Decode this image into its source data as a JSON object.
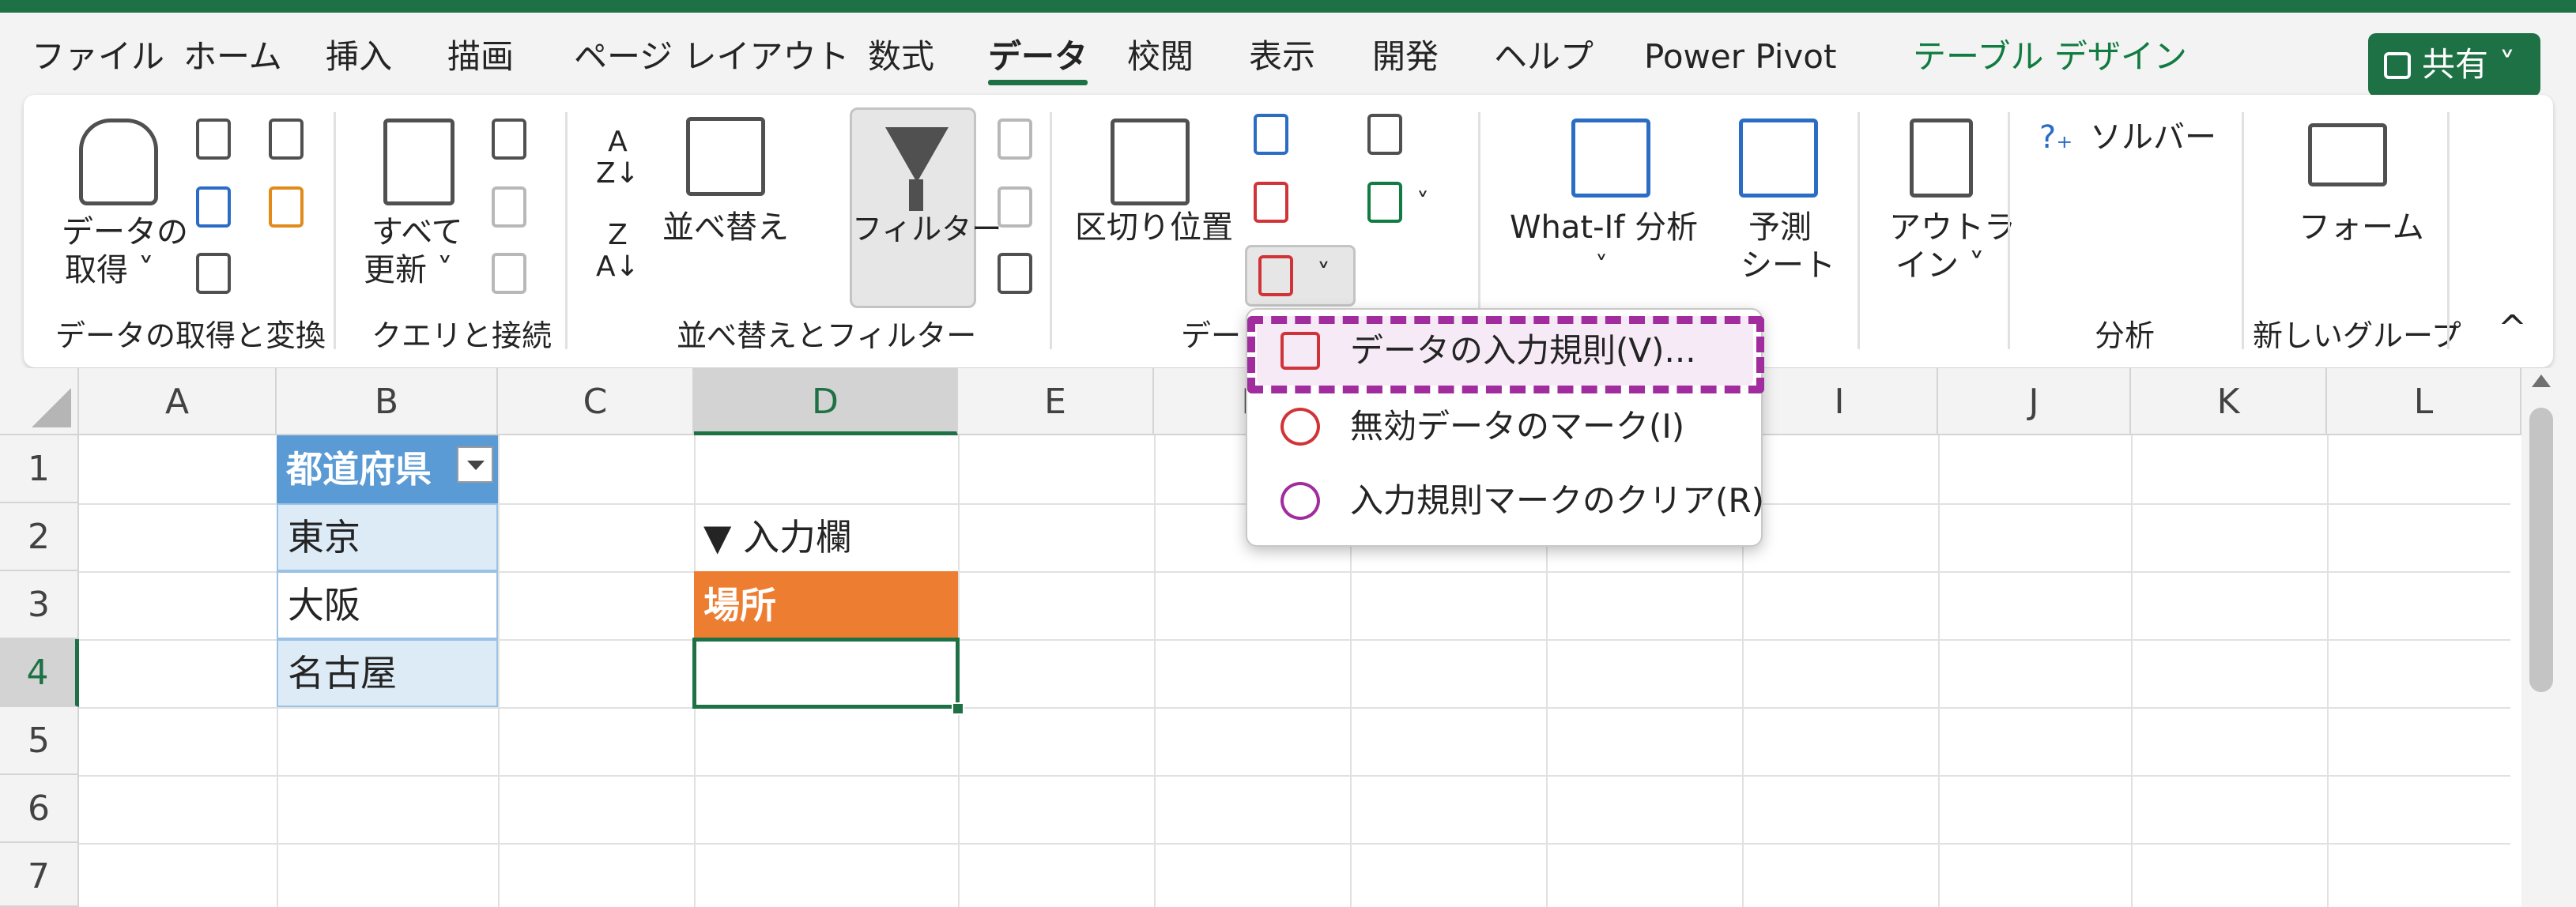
{
  "tabs": [
    "ファイル",
    "ホーム",
    "挿入",
    "描画",
    "ページ レイアウト",
    "数式",
    "データ",
    "校閲",
    "表示",
    "開発",
    "ヘルプ",
    "Power Pivot",
    "テーブル デザイン"
  ],
  "active_tab": "データ",
  "share_label": "共有",
  "ribbon": {
    "get_data_line1": "データの",
    "get_data_line2": "取得",
    "refresh_line1": "すべて",
    "refresh_line2": "更新",
    "sort_label": "並べ替え",
    "filter_label": "フィルター",
    "split_label": "区切り位置",
    "whatif_label": "What-If 分析",
    "forecast_line1": "予測",
    "forecast_line2": "シート",
    "outline_line1": "アウトラ",
    "outline_line2": "イン",
    "solver_label": "ソルバー",
    "form_label": "フォーム",
    "groups": {
      "get_transform": "データの取得と変換",
      "queries": "クエリと接続",
      "sort_filter": "並べ替えとフィルター",
      "data_tools": "デー",
      "analysis": "分析",
      "new_group": "新しいグループ"
    }
  },
  "columns": [
    "A",
    "B",
    "C",
    "D",
    "E",
    "F",
    "",
    "",
    "",
    "I",
    "J",
    "K",
    "L"
  ],
  "rows": [
    "1",
    "2",
    "3",
    "4",
    "5",
    "6",
    "7"
  ],
  "cells": {
    "B1": "都道府県",
    "B2": "東京",
    "B3": "大阪",
    "B4": "名古屋",
    "D2": "▼ 入力欄",
    "D3": "場所",
    "D4": ""
  },
  "dropdown": {
    "items": [
      {
        "label": "データの入力規則(V)..."
      },
      {
        "label": "無効データのマーク(I)"
      },
      {
        "label": "入力規則マークのクリア(R)"
      }
    ]
  },
  "colors": {
    "accent": "#1e7145",
    "table_header": "#5b9bd5",
    "input_label": "#ed7d31",
    "highlight": "#a02c9e"
  }
}
